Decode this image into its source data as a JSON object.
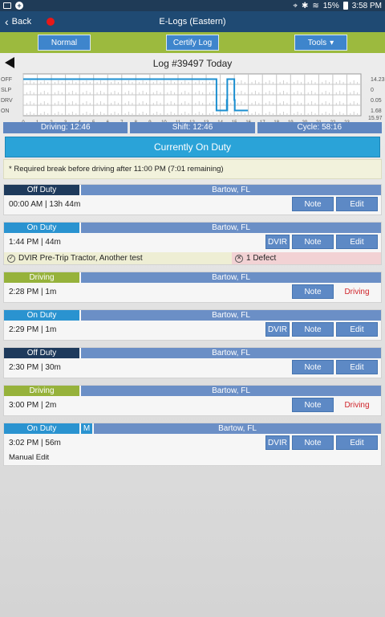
{
  "status_bar": {
    "battery": "15%",
    "time": "3:58 PM"
  },
  "header": {
    "back_label": "Back",
    "title": "E-Logs (Eastern)"
  },
  "toolbar": {
    "normal_label": "Normal",
    "certify_label": "Certify Log",
    "tools_label": "Tools"
  },
  "log": {
    "title": "Log #39497 Today",
    "graph": {
      "rows": [
        "OFF",
        "SLP",
        "DRV",
        "ON"
      ],
      "hours": [
        "0",
        "1",
        "2",
        "3",
        "4",
        "5",
        "6",
        "7",
        "8",
        "9",
        "10",
        "11",
        "12",
        "13",
        "14",
        "15",
        "16",
        "17",
        "18",
        "19",
        "20",
        "21",
        "22",
        "23"
      ],
      "totals": [
        "14.23",
        "0",
        "0.05",
        "1.68"
      ],
      "grand_total": "15.97"
    },
    "summary": {
      "driving": "Driving: 12:46",
      "shift": "Shift: 12:46",
      "cycle": "Cycle: 58:16"
    },
    "status": "Currently On Duty",
    "notice": "* Required break before driving after 11:00 PM (7:01 remaining)"
  },
  "events": [
    {
      "type": "Off Duty",
      "kind": "off",
      "location": "Bartow, FL",
      "time": "00:00 AM | 13h 44m",
      "buttons": [
        "Note",
        "Edit"
      ],
      "tag": ""
    },
    {
      "type": "On Duty",
      "kind": "on",
      "location": "Bartow, FL",
      "time": "1:44 PM | 44m",
      "buttons": [
        "DVIR",
        "Note",
        "Edit"
      ],
      "tag": "",
      "dvir_ok": "DVIR Pre-Trip Tractor, Another test",
      "dvir_defect": "1 Defect"
    },
    {
      "type": "Driving",
      "kind": "drv",
      "location": "Bartow, FL",
      "time": "2:28 PM | 1m",
      "buttons": [
        "Note"
      ],
      "tag": "Driving"
    },
    {
      "type": "On Duty",
      "kind": "on",
      "location": "Bartow, FL",
      "time": "2:29 PM | 1m",
      "buttons": [
        "DVIR",
        "Note",
        "Edit"
      ],
      "tag": ""
    },
    {
      "type": "Off Duty",
      "kind": "off",
      "location": "Bartow, FL",
      "time": "2:30 PM | 30m",
      "buttons": [
        "Note",
        "Edit"
      ],
      "tag": ""
    },
    {
      "type": "Driving",
      "kind": "drv",
      "location": "Bartow, FL",
      "time": "3:00 PM | 2m",
      "buttons": [
        "Note"
      ],
      "tag": "Driving"
    },
    {
      "type": "On Duty",
      "kind": "on",
      "location": "Bartow, FL",
      "mark": "M",
      "time": "3:02 PM | 56m",
      "buttons": [
        "DVIR",
        "Note",
        "Edit"
      ],
      "tag": "",
      "note": "Manual Edit"
    }
  ]
}
